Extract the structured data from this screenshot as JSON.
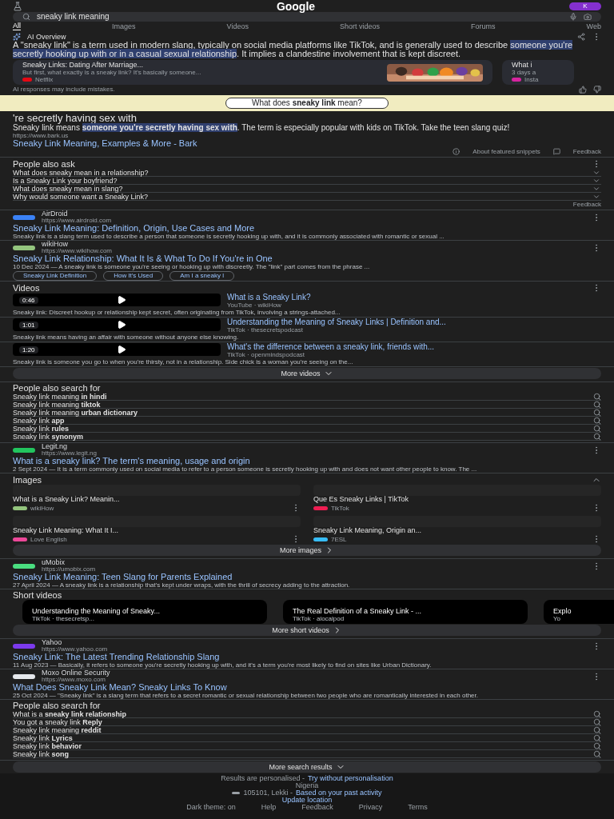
{
  "header": {
    "logo": "Google",
    "avatar": "K"
  },
  "search": {
    "value": "sneaky link meaning"
  },
  "tabs": [
    {
      "label": "All",
      "selected": true
    },
    {
      "label": "Images",
      "selected": false
    },
    {
      "label": "Videos",
      "selected": false
    },
    {
      "label": "Short videos",
      "selected": false
    },
    {
      "label": "Forums",
      "selected": false
    },
    {
      "label": "Web",
      "selected": false
    }
  ],
  "ai_overview": {
    "title": "AI Overview",
    "text": "A \"sneaky link\" is a term used in modern slang, typically on social media platforms like TikTok, and is generally used to describe **someone you're secretly hooking up with or in a casual sexual relationship**. It implies a clandestine involvement that is kept discreet.",
    "sources": [
      {
        "title": "Sneaky Links: Dating After Marriage...",
        "snippet": "But first, what exactly is a sneaky link? It's basically someone...",
        "site": "Netflix",
        "color": "#e50914",
        "picture": true
      },
      {
        "title": "What i",
        "snippet": "3 days a",
        "site": "Insta",
        "color": "#d6249f",
        "picture": false
      }
    ],
    "note": "AI responses may include mistakes."
  },
  "featured": {
    "question": "What does **sneaky link** mean?",
    "heading": "'re secretly having sex with",
    "text": "Sneaky link means **someone you're secretly having sex with**. The term is especially popular with kids on TikTok. Take the teen slang quiz!",
    "url": "https://www.bark.us",
    "title": "Sneaky Link Meaning, Examples & More - Bark",
    "about": "About featured snippets",
    "feedback": "Feedback"
  },
  "sections": [
    {
      "kind": "questions",
      "title": "People also ask",
      "items": [
        "What does sneaky mean in a relationship?",
        "Is a Sneaky Link your boyfriend?",
        "What does sneaky mean in slang?",
        "Why would someone want a Sneaky Link?"
      ],
      "feedback": "Feedback"
    },
    {
      "kind": "result",
      "site": "AirDroid",
      "url": "https://www.airdroid.com",
      "color": "#3b82f6",
      "title": "Sneaky Link Meaning: Definition, Origin, Use Cases and More",
      "snippet": "Sneaky link is a slang term used to describe a person that someone is secretly hooking up with, and it is commonly associated with romantic or sexual ..."
    },
    {
      "kind": "result",
      "site": "wikiHow",
      "url": "https://www.wikihow.com",
      "color": "#93c47d",
      "title": "Sneaky Link Relationship: What It Is & What To Do If You're in One",
      "snippet": "10 Dec 2024 — A sneaky link is someone you're seeing or hooking up with discreetly. The \"link\" part comes from the phrase ...",
      "chips": [
        "Sneaky Link Definition",
        "How It's Used",
        "Am I a sneaky l"
      ]
    },
    {
      "kind": "videos",
      "title": "Videos",
      "items": [
        {
          "title": "What is a Sneaky Link?",
          "source": "YouTube · wikiHow",
          "duration": "0:46",
          "text": "Sneaky link: Discreet hookup or relationship kept secret, often originating from TikTok, involving a strings-attached..."
        },
        {
          "title": "Understanding the Meaning of Sneaky Links | Definition and...",
          "source": "TikTok · thesecretspodcast",
          "duration": "1:01",
          "text": "Sneaky link means having an affair with someone without anyone else knowing."
        },
        {
          "title": "What's the difference between a sneaky link, friends with...",
          "source": "TikTok · openmindspodcast",
          "duration": "1:20",
          "text": "Sneaky link is someone you go to when you're thirsty, not in a relationship. Side chick is a woman you're seeing on the..."
        }
      ],
      "more": "More videos"
    },
    {
      "kind": "related",
      "title": "People also search for",
      "items": [
        "Sneaky link meaning **in hindi**",
        "Sneaky link meaning **tiktok**",
        "Sneaky link meaning **urban dictionary**",
        "Sneaky link **app**",
        "Sneaky link **rules**",
        "Sneaky link **synonym**"
      ]
    },
    {
      "kind": "result",
      "site": "Legit.ng",
      "url": "https://www.legit.ng",
      "color": "#22c55e",
      "title": "What is a sneaky link? The term's meaning, usage and origin",
      "snippet": "2 Sept 2024 — It is a term commonly used on social media to refer to a person someone is secretly hooking up with and does not want other people to know. The ..."
    },
    {
      "kind": "images",
      "title": "Images",
      "items": [
        {
          "caption": "What is a Sneaky Link? Meanin...",
          "site": "wikiHow",
          "color": "#93c47d"
        },
        {
          "caption": "Que Es Sneaky Links | TikTok",
          "site": "TikTok",
          "color": "#ee1d52"
        },
        {
          "caption": "Sneaky Link Meaning: What It I...",
          "site": "Love English",
          "color": "#ec4899"
        },
        {
          "caption": "Sneaky Link Meaning, Origin an...",
          "site": "7ESL",
          "color": "#38bdf8"
        }
      ],
      "more": "More images"
    },
    {
      "kind": "result",
      "site": "uMobix",
      "url": "https://umobix.com",
      "color": "#4ade80",
      "title": "Sneaky Link Meaning: Teen Slang for Parents Explained",
      "snippet": "27 April 2024 — A sneaky link is a relationship that's kept under wraps, with the thrill of secrecy adding to the attraction."
    },
    {
      "kind": "shorts",
      "title": "Short videos",
      "items": [
        {
          "title": "Understanding the Meaning of Sneaky...",
          "source": "TikTok · thesecretsp..."
        },
        {
          "title": "The Real Definition of a Sneaky Link - ...",
          "source": "TikTok · alocalpod"
        },
        {
          "title": "Explo",
          "source": "Yo"
        }
      ],
      "more": "More short videos"
    },
    {
      "kind": "result",
      "site": "Yahoo",
      "url": "https://www.yahoo.com",
      "color": "#7c3aed",
      "title": "Sneaky Link: The Latest Trending Relationship Slang",
      "snippet": "11 Aug 2023 — Basically, it refers to someone you're secretly hooking up with, and it's a term you're most likely to find on sites like Urban Dictionary."
    },
    {
      "kind": "result",
      "site": "Moxo Online Security",
      "url": "https://www.moxo.com",
      "color": "#e5e7eb",
      "title": "What Does Sneaky Link Mean? Sneaky Links To Know",
      "snippet": "25 Oct 2024 — \"Sneaky link\" is a slang term that refers to a secret romantic or sexual relationship between two people who are romantically interested in each other."
    },
    {
      "kind": "related",
      "title": "People also search for",
      "items": [
        "What is a **sneaky link relationship**",
        "You got a sneaky link **Reply**",
        "Sneaky link meaning **reddit**",
        "Sneaky link **Lyrics**",
        "Sneaky link **behavior**",
        "Sneaky link **song**"
      ]
    }
  ],
  "more_results": "More search results",
  "footer": {
    "personalised": "Results are personalised -",
    "personalise_link": "Try without personalisation",
    "country": "Nigeria",
    "location": "105101, Lekki -",
    "activity_link": "Based on your past activity",
    "update_link": "Update location",
    "links": [
      "Dark theme: on",
      "Help",
      "Feedback",
      "Privacy",
      "Terms"
    ]
  }
}
